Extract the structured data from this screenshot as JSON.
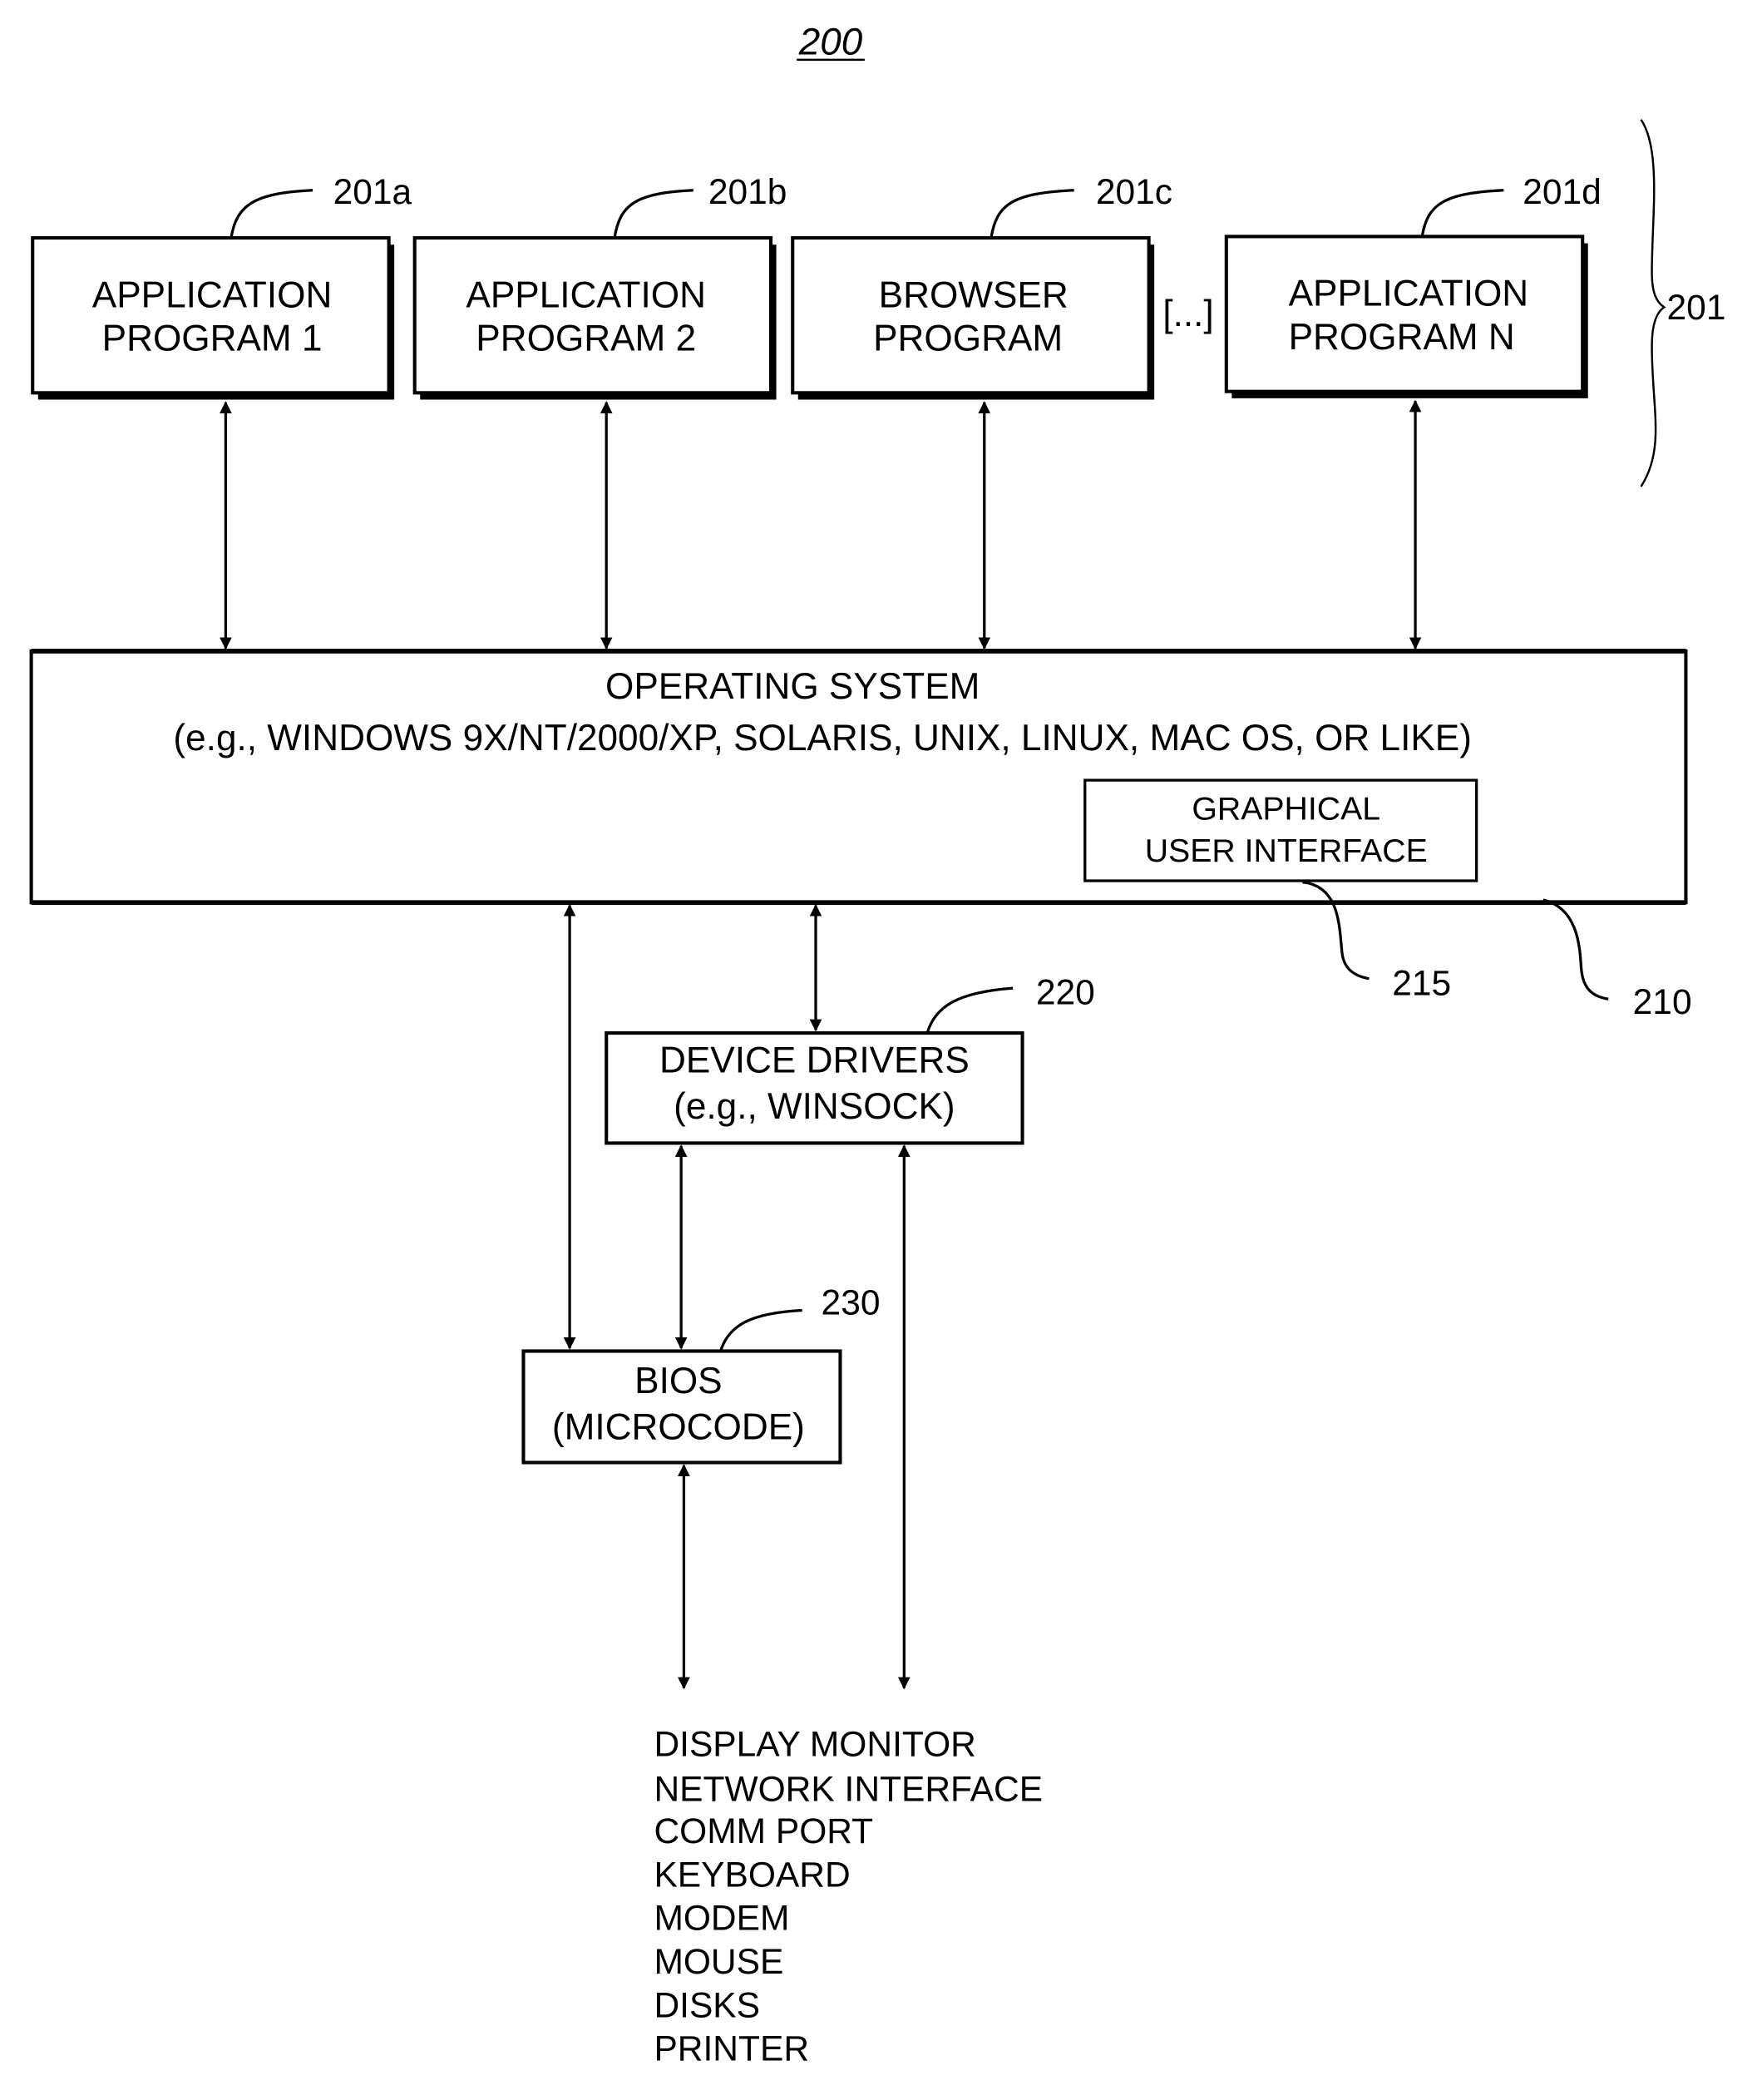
{
  "figure": {
    "number": "200"
  },
  "applications": {
    "group_ref": "201",
    "ellipsis": "[...]",
    "items": [
      {
        "ref": "201a",
        "line1": "APPLICATION",
        "line2": "PROGRAM 1"
      },
      {
        "ref": "201b",
        "line1": "APPLICATION",
        "line2": "PROGRAM 2"
      },
      {
        "ref": "201c",
        "line1": "BROWSER",
        "line2": "PROGRAM"
      },
      {
        "ref": "201d",
        "line1": "APPLICATION",
        "line2": "PROGRAM N"
      }
    ]
  },
  "operating_system": {
    "ref": "210",
    "title": "OPERATING SYSTEM",
    "subtitle": "(e.g., WINDOWS 9X/NT/2000/XP, SOLARIS, UNIX, LINUX, MAC OS, OR LIKE)",
    "gui": {
      "ref": "215",
      "line1": "GRAPHICAL",
      "line2": "USER INTERFACE"
    }
  },
  "device_drivers": {
    "ref": "220",
    "line1": "DEVICE DRIVERS",
    "line2": "(e.g., WINSOCK)"
  },
  "bios": {
    "ref": "230",
    "line1": "BIOS",
    "line2": "(MICROCODE)"
  },
  "io_devices": [
    "DISPLAY MONITOR",
    "NETWORK INTERFACE",
    "COMM PORT",
    "KEYBOARD",
    "MODEM",
    "MOUSE",
    "DISKS",
    "PRINTER"
  ]
}
